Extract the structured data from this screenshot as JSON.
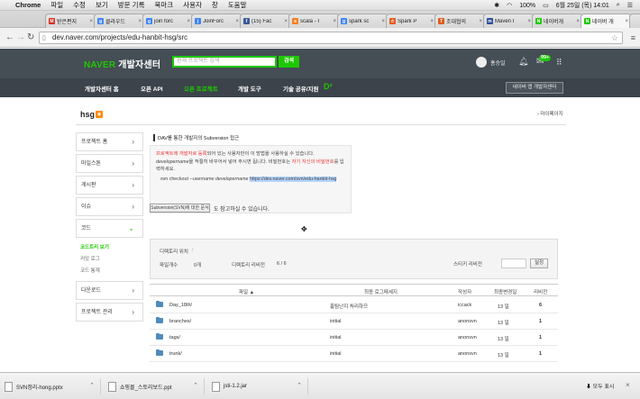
{
  "macbar": {
    "apple": "",
    "app": "Chrome",
    "menus": [
      "파일",
      "수정",
      "보기",
      "방문 기록",
      "북마크",
      "사용자",
      "창",
      "도움말"
    ],
    "battery": "100%",
    "datetime": "6월 25일 (목)  14:01",
    "status_icons": [
      "bluetooth-icon",
      "wifi-icon",
      "battery-icon",
      "search-icon",
      "list-icon"
    ]
  },
  "tabs": [
    {
      "label": "받은편지",
      "icon": "gmail-icon",
      "color": "#d93025",
      "glyph": "M"
    },
    {
      "label": "클라우드",
      "icon": "google-icon",
      "color": "#4285f4",
      "glyph": "g"
    },
    {
      "label": "join forc",
      "icon": "google-icon",
      "color": "#4285f4",
      "glyph": "g"
    },
    {
      "label": "JoinForc",
      "icon": "gmail-icon",
      "color": "#4285f4",
      "glyph": "j"
    },
    {
      "label": "(15) Fac",
      "icon": "facebook-icon",
      "color": "#3b5998",
      "glyph": "f"
    },
    {
      "label": "scala - I",
      "icon": "stackoverflow-icon",
      "color": "#f48024",
      "glyph": "s"
    },
    {
      "label": "spark sc",
      "icon": "google-icon",
      "color": "#4285f4",
      "glyph": "g"
    },
    {
      "label": "Spark P",
      "icon": "spark-icon",
      "color": "#e25a1c",
      "glyph": "☆"
    },
    {
      "label": "조대협의",
      "icon": "blog-icon",
      "color": "#e25a1c",
      "glyph": "T"
    },
    {
      "label": "Maven I",
      "icon": "maven-icon",
      "color": "#2b4c9b",
      "glyph": "m"
    },
    {
      "label": "네이버개",
      "icon": "naver-icon",
      "color": "#1ec800",
      "glyph": "N"
    },
    {
      "label": "네이버 개",
      "icon": "naver-icon",
      "color": "#1ec800",
      "glyph": "N",
      "active": true
    }
  ],
  "address": {
    "url": "dev.naver.com/projects/edu-hanbit-hsg/src"
  },
  "header": {
    "logo_brand": "NAVER",
    "logo_text": "개발자센터",
    "search_placeholder": "현재 프로젝트 검색",
    "search_button": "검색",
    "username": "홍승일",
    "mail_badge": "99+"
  },
  "gnb": {
    "items": [
      "개발자센터 홈",
      "오픈 API",
      "오픈 프로젝트",
      "개발 도구",
      "기술 공유/지원"
    ],
    "active_index": 2,
    "d2_logo": "D²",
    "app_button": "네이버 앱 개발자센터"
  },
  "page": {
    "title": "hsg",
    "mypage": "마이페이지"
  },
  "sidebar": {
    "items": [
      {
        "label": "프로젝트 홈"
      },
      {
        "label": "마일스톤"
      },
      {
        "label": "게시판"
      },
      {
        "label": "이슈"
      },
      {
        "label": "코드",
        "open": true
      },
      {
        "label": "다운로드"
      },
      {
        "label": "프로젝트 관리"
      }
    ],
    "code_subitems": [
      "코드트리 보기",
      "커밋 로그",
      "코드 통계"
    ]
  },
  "svn": {
    "title": "DAV를 통한 개발자의 Subversion 접근",
    "line1_red": "프로젝트에 개발자로 등록",
    "line1_rest": "되어 있는 사용자만이 이 방법을 사용하실 수 있습니다.",
    "line2_code": "developername",
    "line2_rest": "을 적절히 바꾸어서 넣어 주시면 됩니다. 비밀번호는",
    "line2_red": "자기 자신의 비밀번호",
    "line2_end": "를 입력하세요.",
    "cmd_prefix": "svn checkout --username",
    "cmd_user": "developername",
    "cmd_url": "https://dev.naver.com/svn/edu-hanbit-hsg",
    "ref_button": "Subversion(SVN)에 대한 문서",
    "ref_text": "도 참고하실 수 있습니다."
  },
  "repo_info": {
    "dir_location_label": "디렉토리 위치",
    "dir_location_value": ":",
    "file_count_label": "파일개수",
    "file_count_value": "0개",
    "dir_rev_label": "디렉토리 리비전",
    "dir_rev_value": "6 / 6",
    "sticky_rev_label": "스티키 리비전",
    "set_button": "설정"
  },
  "table": {
    "headers": [
      "파일 ▲",
      "최종 로그메세지",
      "작성자",
      "최종변경일",
      "리비전"
    ],
    "rows": [
      {
        "name": "Day_18th/",
        "log": "홍팀난지 처리하므",
        "author": "iccack",
        "date": "13 일",
        "rev": "6"
      },
      {
        "name": "branches/",
        "log": "initial",
        "author": "anonsvn",
        "date": "13 일",
        "rev": "1"
      },
      {
        "name": "tags/",
        "log": "initial",
        "author": "anonsvn",
        "date": "13 일",
        "rev": "1"
      },
      {
        "name": "trunk/",
        "log": "initial",
        "author": "anonsvn",
        "date": "13 일",
        "rev": "1"
      }
    ]
  },
  "downloads": {
    "items": [
      "SVN정리-hong.pptx",
      "쇼핑몰_스토리보드.ppt",
      "jsti-1.2.jar"
    ],
    "show_all": "모두 표시"
  }
}
